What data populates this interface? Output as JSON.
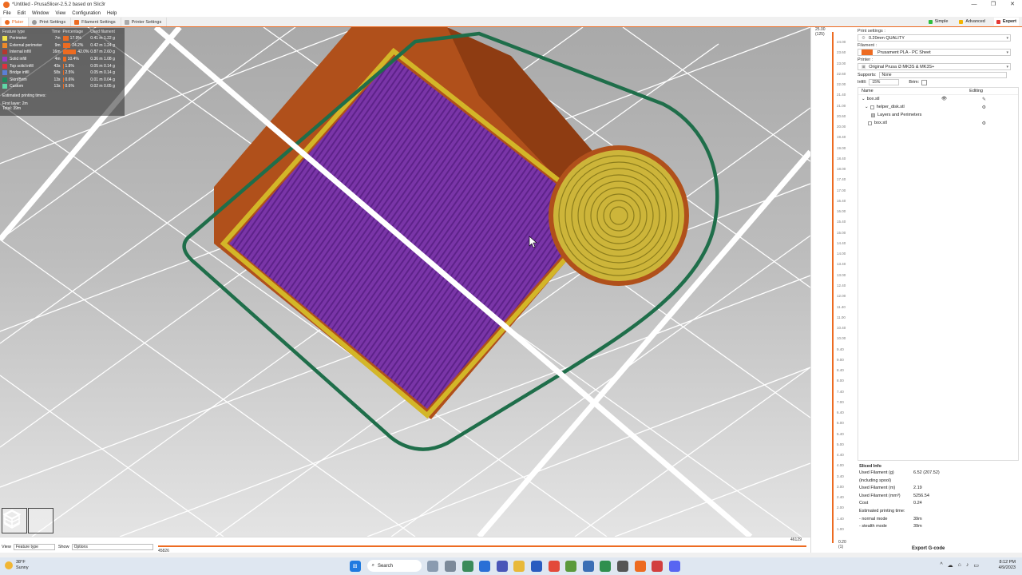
{
  "window": {
    "title": "*Untitled - PrusaSlicer-2.5.2 based on Slic3r",
    "controls": [
      "—",
      "❐",
      "✕"
    ]
  },
  "menu": [
    "File",
    "Edit",
    "Window",
    "View",
    "Configuration",
    "Help"
  ],
  "tabs": [
    "Plater",
    "Print Settings",
    "Filament Settings",
    "Printer Settings"
  ],
  "modes": [
    "Simple",
    "Advanced",
    "Expert"
  ],
  "legend": {
    "headers": [
      "Feature type",
      "Time",
      "Percentage",
      "Used filament"
    ],
    "rows": [
      {
        "name": "Perimeter",
        "time": "7m",
        "pct": "17.9%",
        "pct_value": 17.9,
        "filament": "0.41 m  1.22 g",
        "color": "#f2e44b"
      },
      {
        "name": "External perimeter",
        "time": "9m",
        "pct": "24.2%",
        "pct_value": 24.2,
        "filament": "0.42 m  1.24 g",
        "color": "#ed8a2a"
      },
      {
        "name": "Internal infill",
        "time": "16m",
        "pct": "42.0%",
        "pct_value": 42.0,
        "filament": "0.87 m  2.60 g",
        "color": "#b5382f"
      },
      {
        "name": "Solid infill",
        "time": "4m",
        "pct": "10.4%",
        "pct_value": 10.4,
        "filament": "0.36 m  1.08 g",
        "color": "#9a39c8"
      },
      {
        "name": "Top solid infill",
        "time": "43s",
        "pct": "1.8%",
        "pct_value": 1.8,
        "filament": "0.05 m  0.14 g",
        "color": "#e0313d"
      },
      {
        "name": "Bridge infill",
        "time": "58s",
        "pct": "2.5%",
        "pct_value": 2.5,
        "filament": "0.05 m  0.14 g",
        "color": "#5b7fd6"
      },
      {
        "name": "Skirt/Brim",
        "time": "13s",
        "pct": "0.6%",
        "pct_value": 0.6,
        "filament": "0.01 m  0.04 g",
        "color": "#1e8a5a"
      },
      {
        "name": "Custom",
        "time": "13s",
        "pct": "0.6%",
        "pct_value": 0.6,
        "filament": "0.02 m  0.05 g",
        "color": "#5fd9a8"
      }
    ],
    "estimated_label": "Estimated printing times:",
    "first_layer": "First layer: 2m",
    "total": "Total:       39m"
  },
  "layer_slider": {
    "top": [
      "25.00",
      "(125)"
    ],
    "ticks": [
      "24.00",
      "23.60",
      "23.00",
      "22.60",
      "22.00",
      "21.40",
      "21.00",
      "20.60",
      "20.00",
      "19.40",
      "19.00",
      "18.40",
      "18.00",
      "17.40",
      "17.00",
      "16.40",
      "16.00",
      "15.40",
      "15.00",
      "14.40",
      "14.00",
      "13.40",
      "13.00",
      "12.40",
      "12.00",
      "11.40",
      "11.00",
      "10.40",
      "10.00",
      "9.40",
      "9.00",
      "8.40",
      "8.00",
      "7.40",
      "7.00",
      "6.40",
      "6.00",
      "5.40",
      "5.00",
      "4.40",
      "4.00",
      "3.40",
      "3.00",
      "2.40",
      "2.00",
      "1.40",
      "1.00"
    ],
    "bottom": [
      "0.20",
      "(1)"
    ]
  },
  "bottombar": {
    "view_label": "View",
    "view_value": "Feature type",
    "show_label": "Show",
    "show_value": "Options",
    "left_num": "45826",
    "right_num": "46129"
  },
  "sidebar": {
    "print_settings_label": "Print settings :",
    "print_settings_value": "0.20mm QUALITY",
    "filament_label": "Filament :",
    "filament_value": "Prusament PLA - PC Sheet",
    "filament_color": "#ed6b21",
    "printer_label": "Printer :",
    "printer_value": "Original Prusa i3 MK3S & MK3S+",
    "supports_label": "Supports:",
    "supports_value": "None",
    "infill_label": "Infill:",
    "infill_value": "15%",
    "brim_label": "Brim:",
    "objects_header_name": "Name",
    "objects_header_editing": "Editing",
    "objects": [
      "box.stl",
      "helper_disk.stl",
      "Layers and Perimeters",
      "box.stl"
    ],
    "sliced_title": "Sliced Info",
    "sliced_rows": [
      {
        "k": "Used Filament (g)",
        "v": "6.52 (207.52)"
      },
      {
        "k": "  (including spool)",
        "v": ""
      },
      {
        "k": "Used Filament (m)",
        "v": "2.19"
      },
      {
        "k": "Used Filament (mm³)",
        "v": "5256.54"
      },
      {
        "k": "Cost",
        "v": "0.24"
      },
      {
        "k": "Estimated printing time:",
        "v": ""
      },
      {
        "k": " - normal mode",
        "v": "39m"
      },
      {
        "k": " - stealth mode",
        "v": "39m"
      }
    ],
    "export_label": "Export G-code"
  },
  "taskbar": {
    "temp": "38°F",
    "weather": "Sunny",
    "search": "Search",
    "time": "8:12 PM",
    "date": "4/9/2023"
  }
}
